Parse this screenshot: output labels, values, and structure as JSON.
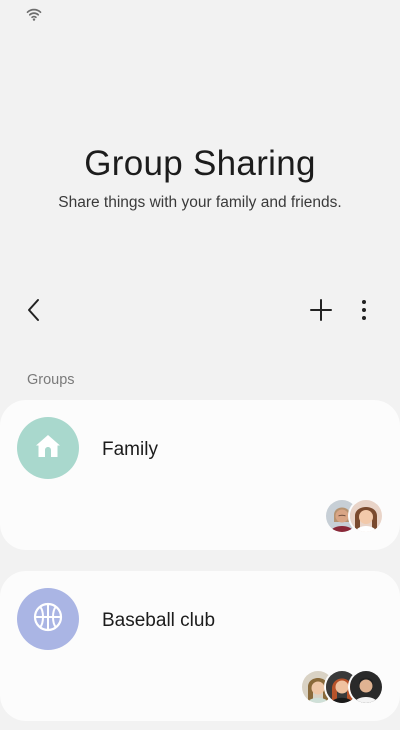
{
  "header": {
    "title": "Group Sharing",
    "subtitle": "Share things with your family and friends."
  },
  "status_bar": {
    "icons": [
      "wifi-icon"
    ]
  },
  "toolbar": {
    "icons": [
      "back-icon",
      "add-icon",
      "more-options-icon"
    ]
  },
  "groups_section": {
    "label": "Groups",
    "groups": [
      {
        "name": "Family",
        "icon": "home-icon",
        "icon_color": "#a9d8cd",
        "member_count": 2
      },
      {
        "name": "Baseball club",
        "icon": "basketball-icon",
        "icon_color": "#aab5e4",
        "member_count": 3
      }
    ]
  }
}
